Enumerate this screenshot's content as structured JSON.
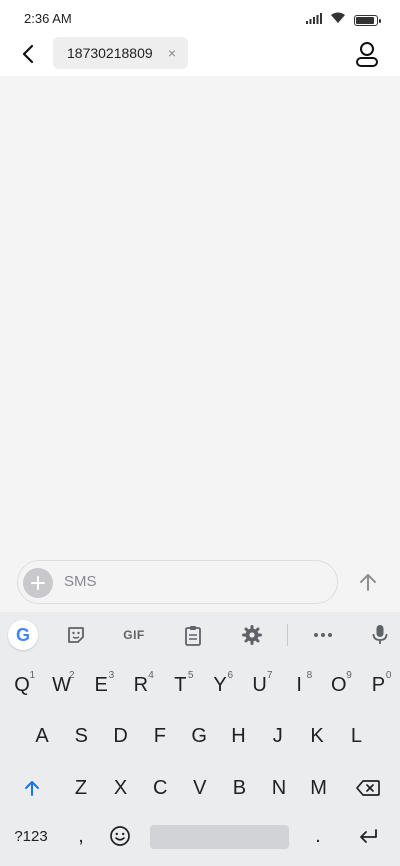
{
  "status_bar": {
    "time": "2:36 AM",
    "icons": [
      "signal-icon",
      "wifi-icon",
      "battery-charging-icon"
    ]
  },
  "header": {
    "back_icon": "chevron-left-icon",
    "recipient": "18730218809",
    "remove_icon": "close-icon",
    "remove_glyph": "×",
    "contact_icon": "person-icon"
  },
  "composer": {
    "add_icon": "plus-icon",
    "placeholder": "SMS",
    "send_icon": "arrow-up-icon"
  },
  "keyboard": {
    "toolbar": {
      "google_label": "G",
      "gif_label": "GIF",
      "icons": [
        "google-icon",
        "sticker-icon",
        "gif-icon",
        "clipboard-icon",
        "settings-icon",
        "more-icon",
        "mic-icon"
      ]
    },
    "row1": [
      {
        "label": "Q",
        "hint": "1"
      },
      {
        "label": "W",
        "hint": "2"
      },
      {
        "label": "E",
        "hint": "3"
      },
      {
        "label": "R",
        "hint": "4"
      },
      {
        "label": "T",
        "hint": "5"
      },
      {
        "label": "Y",
        "hint": "6"
      },
      {
        "label": "U",
        "hint": "7"
      },
      {
        "label": "I",
        "hint": "8"
      },
      {
        "label": "O",
        "hint": "9"
      },
      {
        "label": "P",
        "hint": "0"
      }
    ],
    "row2": [
      "A",
      "S",
      "D",
      "F",
      "G",
      "H",
      "J",
      "K",
      "L"
    ],
    "row3": [
      "Z",
      "X",
      "C",
      "V",
      "B",
      "N",
      "M"
    ],
    "row4": {
      "symbols": "?123",
      "comma": ",",
      "period": "."
    },
    "colors": {
      "accent": "#1a73e8",
      "key_text": "#202124",
      "background": "#eaecee"
    }
  }
}
